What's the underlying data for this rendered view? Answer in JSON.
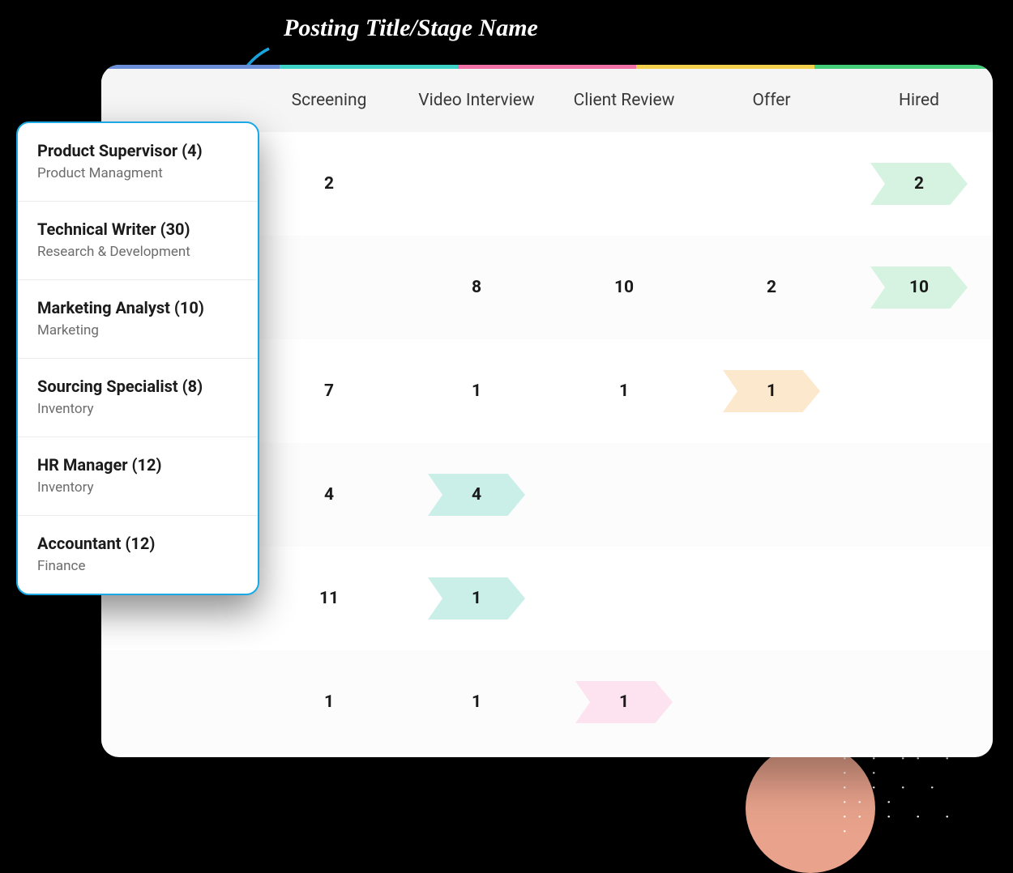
{
  "annotation": "Posting Title/Stage Name",
  "stageColors": [
    "#6a8fd8",
    "#3fd2c7",
    "#f272a8",
    "#f3cf4e",
    "#45cf7a"
  ],
  "stages": [
    "Screening",
    "Video Interview",
    "Client Review",
    "Offer",
    "Hired"
  ],
  "postings": [
    {
      "title": "Product Supervisor (4)",
      "dept": "Product Managment"
    },
    {
      "title": "Technical Writer (30)",
      "dept": "Research & Development"
    },
    {
      "title": "Marketing Analyst (10)",
      "dept": "Marketing"
    },
    {
      "title": "Sourcing Specialist (8)",
      "dept": "Inventory"
    },
    {
      "title": "HR Manager (12)",
      "dept": "Inventory"
    },
    {
      "title": "Accountant (12)",
      "dept": "Finance"
    }
  ],
  "rows": [
    [
      {
        "v": "2"
      },
      {
        "v": ""
      },
      {
        "v": ""
      },
      {
        "v": ""
      },
      {
        "v": "2",
        "chev": "green"
      }
    ],
    [
      {
        "v": ""
      },
      {
        "v": "8"
      },
      {
        "v": "10"
      },
      {
        "v": "2"
      },
      {
        "v": "10",
        "chev": "green"
      }
    ],
    [
      {
        "v": "7"
      },
      {
        "v": "1"
      },
      {
        "v": "1"
      },
      {
        "v": "1",
        "chev": "orange"
      },
      {
        "v": ""
      }
    ],
    [
      {
        "v": "4"
      },
      {
        "v": "4",
        "chev": "teal"
      },
      {
        "v": ""
      },
      {
        "v": ""
      },
      {
        "v": ""
      }
    ],
    [
      {
        "v": "11"
      },
      {
        "v": "1",
        "chev": "teal"
      },
      {
        "v": ""
      },
      {
        "v": ""
      },
      {
        "v": ""
      }
    ],
    [
      {
        "v": "1"
      },
      {
        "v": "1"
      },
      {
        "v": "1",
        "chev": "pink"
      },
      {
        "v": ""
      },
      {
        "v": ""
      }
    ]
  ]
}
